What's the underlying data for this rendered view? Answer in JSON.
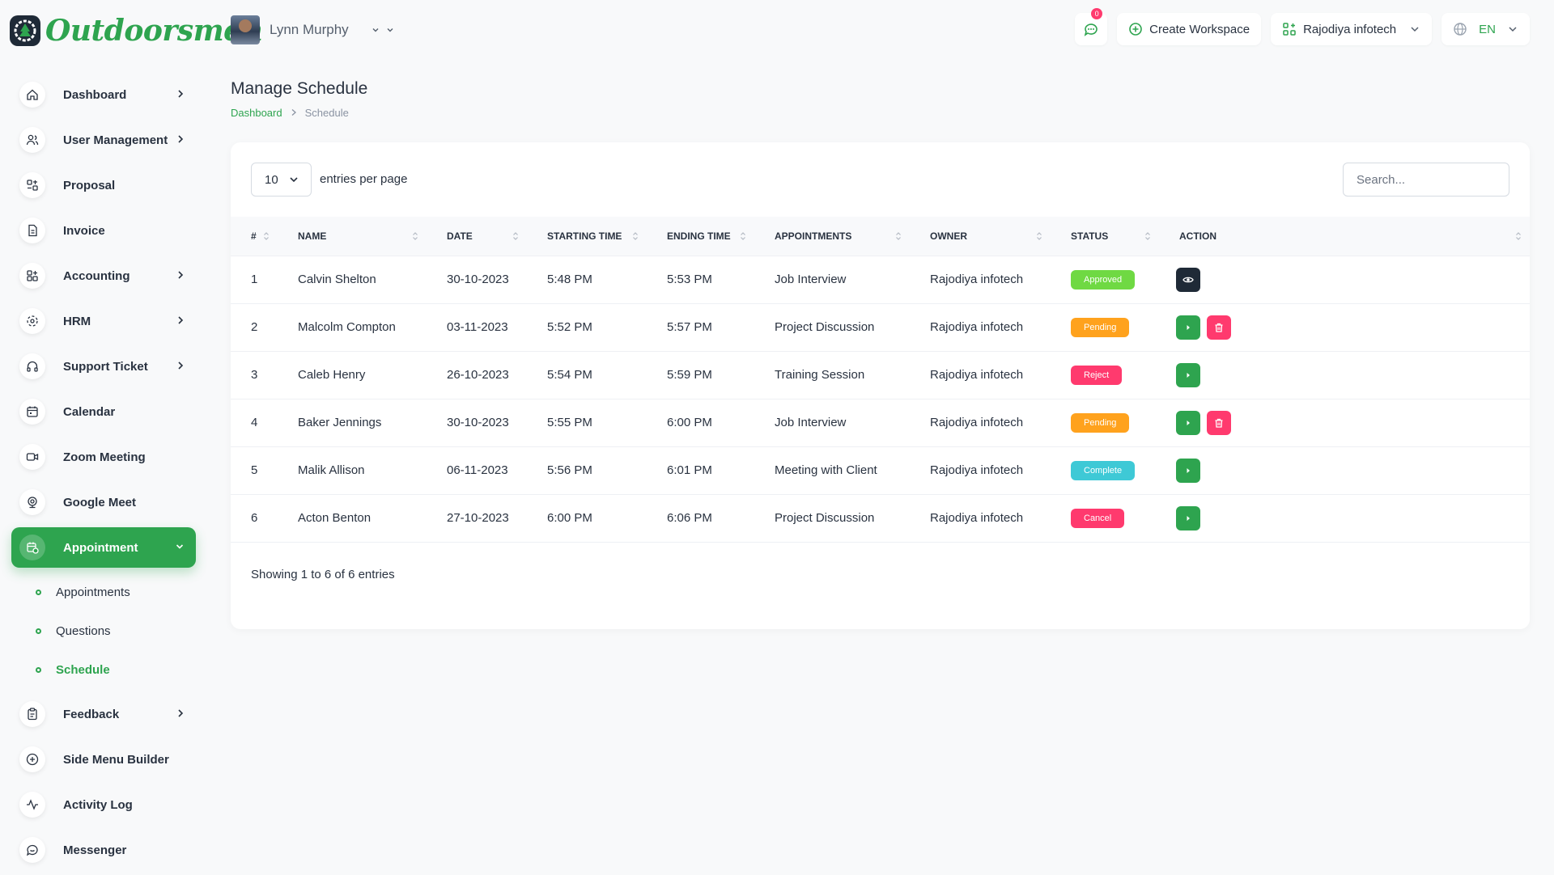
{
  "brand": {
    "name": "Outdoorsmen",
    "color": "#2ea44f"
  },
  "sidebar": {
    "items": [
      {
        "label": "Dashboard",
        "icon": "home-icon",
        "has_chevron": true
      },
      {
        "label": "User Management",
        "icon": "users-icon",
        "has_chevron": true
      },
      {
        "label": "Proposal",
        "icon": "proposal-icon",
        "has_chevron": false
      },
      {
        "label": "Invoice",
        "icon": "file-invoice-icon",
        "has_chevron": false
      },
      {
        "label": "Accounting",
        "icon": "apps-icon",
        "has_chevron": true
      },
      {
        "label": "HRM",
        "icon": "hrm-icon",
        "has_chevron": true
      },
      {
        "label": "Support Ticket",
        "icon": "headset-icon",
        "has_chevron": true
      },
      {
        "label": "Calendar",
        "icon": "calendar-icon",
        "has_chevron": false
      },
      {
        "label": "Zoom Meeting",
        "icon": "video-icon",
        "has_chevron": false
      },
      {
        "label": "Google Meet",
        "icon": "webcam-icon",
        "has_chevron": false
      },
      {
        "label": "Appointment",
        "icon": "calendar-time-icon",
        "has_chevron": true,
        "active": true
      }
    ],
    "submenu": [
      {
        "label": "Appointments"
      },
      {
        "label": "Questions"
      },
      {
        "label": "Schedule",
        "current": true
      }
    ],
    "items_after": [
      {
        "label": "Feedback",
        "icon": "clipboard-icon",
        "has_chevron": true
      },
      {
        "label": "Side Menu Builder",
        "icon": "circle-plus-icon",
        "has_chevron": false
      },
      {
        "label": "Activity Log",
        "icon": "activity-icon",
        "has_chevron": false
      },
      {
        "label": "Messenger",
        "icon": "message-icon",
        "has_chevron": false
      }
    ]
  },
  "topbar": {
    "user_name": "Lynn Murphy",
    "notification_count": "0",
    "create_workspace": "Create Workspace",
    "workspace": "Rajodiya infotech",
    "language": "EN"
  },
  "page": {
    "title": "Manage Schedule",
    "breadcrumb": {
      "root": "Dashboard",
      "current": "Schedule"
    }
  },
  "table_controls": {
    "per_page": "10",
    "per_page_label": "entries per page",
    "search_placeholder": "Search..."
  },
  "table": {
    "columns": [
      "#",
      "NAME",
      "DATE",
      "STARTING TIME",
      "ENDING TIME",
      "APPOINTMENTS",
      "OWNER",
      "STATUS",
      "ACTION"
    ],
    "rows": [
      {
        "num": "1",
        "name": "Calvin Shelton",
        "date": "30-10-2023",
        "start": "5:48 PM",
        "end": "5:53 PM",
        "appointment": "Job Interview",
        "owner": "Rajodiya infotech",
        "status": "Approved",
        "status_color": "#6fd943",
        "actions": [
          "view"
        ]
      },
      {
        "num": "2",
        "name": "Malcolm Compton",
        "date": "03-11-2023",
        "start": "5:52 PM",
        "end": "5:57 PM",
        "appointment": "Project Discussion",
        "owner": "Rajodiya infotech",
        "status": "Pending",
        "status_color": "#ffa21d",
        "actions": [
          "run",
          "delete"
        ]
      },
      {
        "num": "3",
        "name": "Caleb Henry",
        "date": "26-10-2023",
        "start": "5:54 PM",
        "end": "5:59 PM",
        "appointment": "Training Session",
        "owner": "Rajodiya infotech",
        "status": "Reject",
        "status_color": "#ff3a6e",
        "actions": [
          "run"
        ]
      },
      {
        "num": "4",
        "name": "Baker Jennings",
        "date": "30-10-2023",
        "start": "5:55 PM",
        "end": "6:00 PM",
        "appointment": "Job Interview",
        "owner": "Rajodiya infotech",
        "status": "Pending",
        "status_color": "#ffa21d",
        "actions": [
          "run",
          "delete"
        ]
      },
      {
        "num": "5",
        "name": "Malik Allison",
        "date": "06-11-2023",
        "start": "5:56 PM",
        "end": "6:01 PM",
        "appointment": "Meeting with Client",
        "owner": "Rajodiya infotech",
        "status": "Complete",
        "status_color": "#3ec9d6",
        "actions": [
          "run"
        ]
      },
      {
        "num": "6",
        "name": "Acton Benton",
        "date": "27-10-2023",
        "start": "6:00 PM",
        "end": "6:06 PM",
        "appointment": "Project Discussion",
        "owner": "Rajodiya infotech",
        "status": "Cancel",
        "status_color": "#ff3a6e",
        "actions": [
          "run"
        ]
      }
    ]
  },
  "footer": {
    "showing": "Showing 1 to 6 of 6 entries"
  }
}
